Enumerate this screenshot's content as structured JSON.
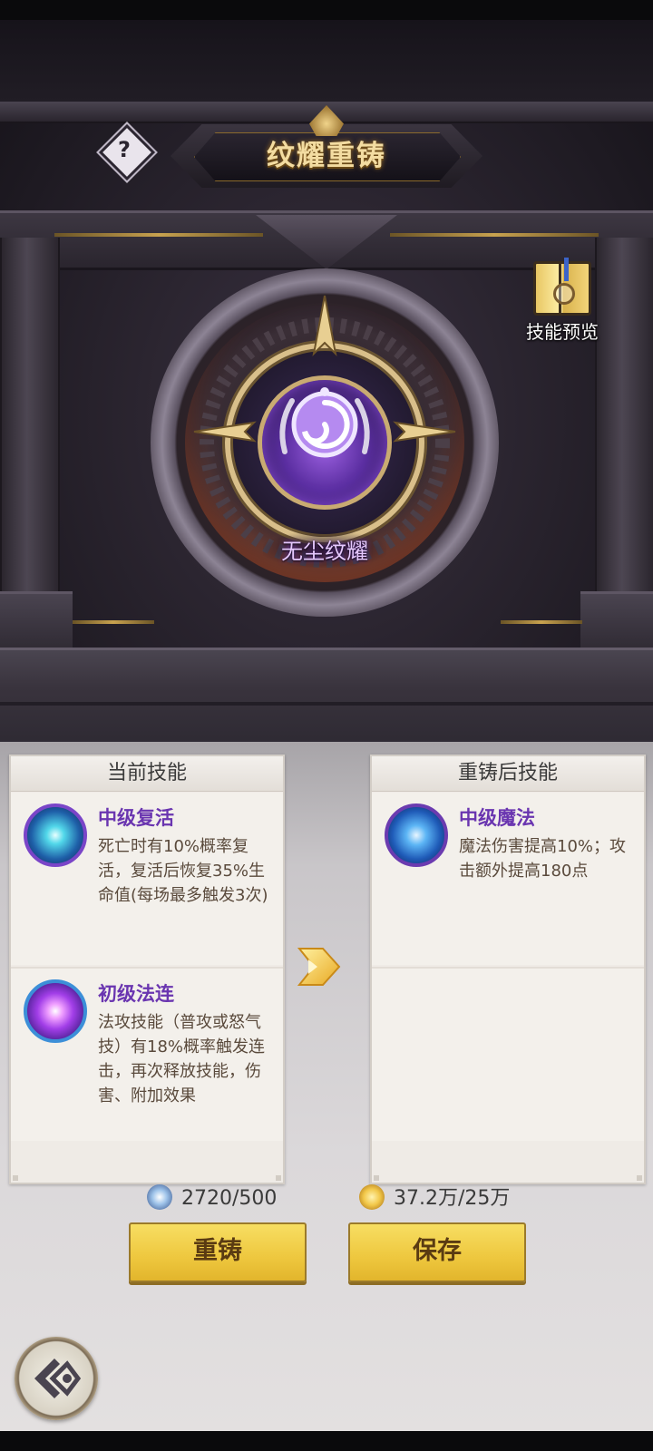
{
  "header": {
    "title": "纹耀重铸",
    "help_icon": "question-mark-icon",
    "help_mark": "?"
  },
  "preview": {
    "label": "技能预览",
    "icon": "skill-book-icon"
  },
  "emblem": {
    "name": "无尘纹耀",
    "icon": "spiral-emblem-icon"
  },
  "current_panel": {
    "title": "当前技能",
    "skills": [
      {
        "name": "中级复活",
        "desc": "死亡时有10%概率复活，复活后恢复35%生命值(每场最多触发3次)",
        "icon": "revive-icon",
        "accent": "#3fd6e8"
      },
      {
        "name": "初级法连",
        "desc": "法攻技能（普攻或怒气技）有18%概率触发连击，再次释放技能，伤害、附加效果",
        "icon": "magic-combo-icon",
        "accent": "#c86bff"
      }
    ]
  },
  "recast_panel": {
    "title": "重铸后技能",
    "skills": [
      {
        "name": "中级魔法",
        "desc": "魔法伤害提高10%；攻击额外提高180点",
        "icon": "magic-swirl-icon",
        "accent": "#4a9cf0"
      }
    ]
  },
  "costs": [
    {
      "value": "2720/500",
      "icon": "rune-coin-icon"
    },
    {
      "value": "37.2万/25万",
      "icon": "gold-coin-icon"
    }
  ],
  "buttons": {
    "recast": "重铸",
    "save": "保存"
  },
  "nav": {
    "back_icon": "back-arrow-icon"
  },
  "colors": {
    "skill_name": "#6a35b0",
    "button": "#f0cc45",
    "title_gold": "#f3dca1"
  }
}
